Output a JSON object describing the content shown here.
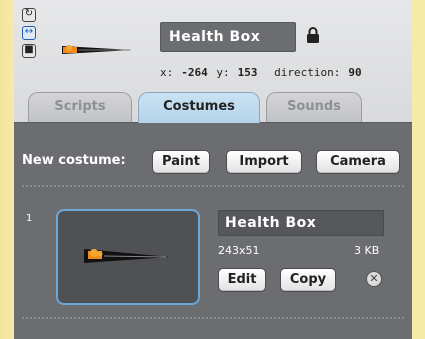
{
  "sprite": {
    "name": "Health Box",
    "x_label": "x:",
    "x": "-264",
    "y_label": "y:",
    "y": "153",
    "direction_label": "direction:",
    "direction": "90"
  },
  "rotation_styles": [
    "rotate-icon",
    "flip-left-right-icon",
    "dont-rotate-icon"
  ],
  "tabs": [
    {
      "label": "Scripts",
      "active": false
    },
    {
      "label": "Costumes",
      "active": true
    },
    {
      "label": "Sounds",
      "active": false
    }
  ],
  "new_costume": {
    "label": "New costume:",
    "paint": "Paint",
    "import": "Import",
    "camera": "Camera"
  },
  "costumes": [
    {
      "number": "1",
      "name": "Health Box",
      "dimensions": "243x51",
      "filesize": "3 KB",
      "edit": "Edit",
      "copy": "Copy",
      "delete_glyph": "✕"
    }
  ],
  "colors": {
    "frame": "#f7e9a8",
    "header_bg": "#e2e3e5",
    "content_bg": "#6b6d70",
    "active_tab": "#c1dcf0",
    "thumb_border": "#6aa7d8",
    "health_bar_orange": "#f28a1a"
  }
}
